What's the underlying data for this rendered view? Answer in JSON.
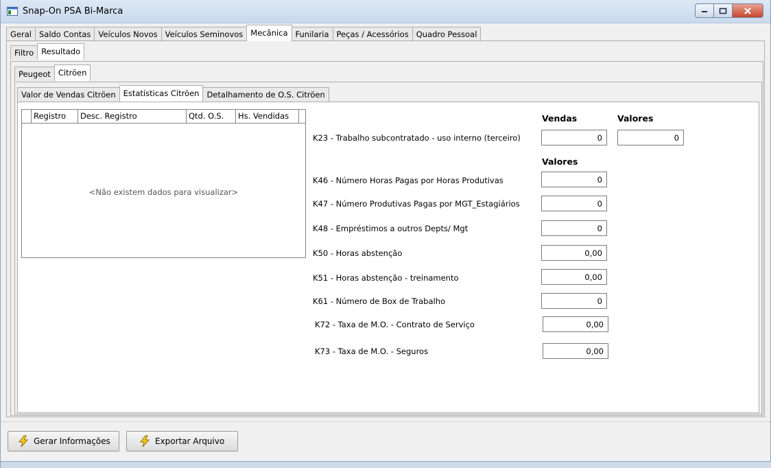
{
  "window": {
    "title": "Snap-On PSA Bi-Marca"
  },
  "main_tabs": [
    "Geral",
    "Saldo Contas",
    "Veículos Novos",
    "Veículos Seminovos",
    "Mecânica",
    "Funilaria",
    "Peças / Acessórios",
    "Quadro Pessoal"
  ],
  "sub_tabs": [
    "Filtro",
    "Resultado"
  ],
  "brand_tabs": [
    "Peugeot",
    "Citröen"
  ],
  "detail_tabs": [
    "Valor de Vendas Citröen",
    "Estatísticas Citröen",
    "Detalhamento de O.S. Citröen"
  ],
  "grid": {
    "columns": [
      "",
      "Registro",
      "Desc. Registro",
      "Qtd. O.S.",
      "Hs. Vendidas"
    ],
    "empty_message": "<Não existem dados para visualizar>"
  },
  "stats": {
    "header_vendas": "Vendas",
    "header_valores": "Valores",
    "header_valores2": "Valores",
    "k23": {
      "label": "K23 - Trabalho subcontratado - uso interno (terceiro)",
      "vendas": "0",
      "valores": "0"
    },
    "k46": {
      "label": "K46 - Número Horas Pagas por Horas Produtivas",
      "value": "0"
    },
    "k47": {
      "label": "K47 - Número Produtivas Pagas por MGT_Estagiários",
      "value": "0"
    },
    "k48": {
      "label": "K48 - Empréstimos a outros Depts/ Mgt",
      "value": "0"
    },
    "k50": {
      "label": "K50 - Horas abstenção",
      "value": "0,00"
    },
    "k51": {
      "label": "K51 - Horas abstenção - treinamento",
      "value": "0,00"
    },
    "k61": {
      "label": "K61 - Número de Box de Trabalho",
      "value": "0"
    },
    "k72": {
      "label": "K72 - Taxa de M.O. - Contrato de Serviço",
      "value": "0,00"
    },
    "k73": {
      "label": "K73 - Taxa de M.O. - Seguros",
      "value": "0,00"
    }
  },
  "buttons": {
    "gerar": "Gerar Informações",
    "exportar": "Exportar Arquivo"
  },
  "icons": {
    "app": "app-window-icon",
    "button": "lightning-icon"
  }
}
